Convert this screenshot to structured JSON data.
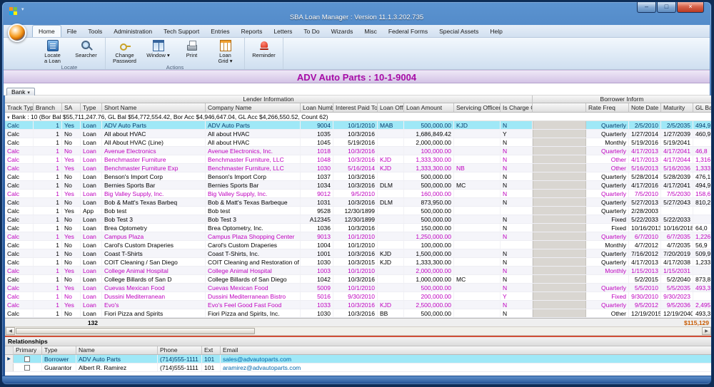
{
  "colors": {
    "banner_text": "#a60ba6",
    "magenta_row_text": "#bf00bf",
    "selected_row_bg": "#9fe8f7",
    "footer_sum_text": "#c85a00",
    "email_link": "#0066aa"
  },
  "window": {
    "title": "SBA Loan Manager : Version 11.1.3.202.735",
    "controls": [
      {
        "name": "minimize",
        "glyph": "–"
      },
      {
        "name": "maximize",
        "glyph": "□"
      },
      {
        "name": "close",
        "glyph": "×"
      }
    ]
  },
  "tabs": [
    "Home",
    "File",
    "Tools",
    "Administration",
    "Tech Support",
    "Entries",
    "Reports",
    "Letters",
    "To Do",
    "Wizards",
    "Misc",
    "Federal Forms",
    "Special Assets",
    "Help"
  ],
  "selected_tab": "Home",
  "ribbon": {
    "groups": [
      {
        "label": "Locate",
        "buttons": [
          {
            "label": "Locate\na Loan",
            "icon": "locate-loan",
            "dropdown": false
          },
          {
            "label": "Searcher",
            "icon": "searcher",
            "dropdown": false
          }
        ]
      },
      {
        "label": "Actions",
        "buttons": [
          {
            "label": "Change\nPassword",
            "icon": "change-password",
            "dropdown": false
          },
          {
            "label": "Window",
            "icon": "window",
            "dropdown": true
          },
          {
            "label": "Print",
            "icon": "print",
            "dropdown": false
          },
          {
            "label": "Loan\nGrid",
            "icon": "loan-grid",
            "dropdown": true
          }
        ]
      },
      {
        "label": "",
        "buttons": [
          {
            "label": "Reminder",
            "icon": "reminder",
            "dropdown": false
          }
        ]
      }
    ]
  },
  "banner": "ADV Auto Parts : 10-1-9004",
  "grid": {
    "group_by_button": "Bank",
    "bands": [
      "Lender Information",
      "Borrower Inform"
    ],
    "columns": [
      "Track Type",
      "Branch",
      "SA",
      "Type",
      "Short Name",
      "Company Name",
      "Loan Number",
      "Interest Paid To",
      "Loan Officer",
      "Loan Amount",
      "Servicing Officer",
      "Is Charge Off",
      "",
      "Rate Freq",
      "Note Date",
      "Maturity",
      "GL Balanc"
    ],
    "group_row": "Bank : 10 (Bor Bal $55,711,247.76, GL Bal $54,772,554.42, Bor Acc $4,946,647.04, GL Acc $4,266,550.52, Count 62)",
    "rows": [
      {
        "style": "selected",
        "cells": [
          "Calc",
          "1",
          "Yes",
          "Loan",
          "ADV Auto Parts",
          "ADV Auto Parts",
          "9004",
          "10/1/2010",
          "MAB",
          "500,000.00",
          "KJD",
          "N",
          "",
          "Quarterly",
          "2/5/2010",
          "2/5/2035",
          "494,9"
        ]
      },
      {
        "style": "",
        "cells": [
          "Calc",
          "1",
          "No",
          "Loan",
          "All about HVAC",
          "All about HVAC",
          "1035",
          "10/3/2016",
          "",
          "1,686,849.42",
          "",
          "Y",
          "",
          "Quarterly",
          "1/27/2014",
          "1/27/2039",
          "460,9"
        ]
      },
      {
        "style": "",
        "cells": [
          "Calc",
          "1",
          "No",
          "Loan",
          "All About HVAC (Line)",
          "All about HVAC",
          "1045",
          "5/19/2016",
          "",
          "2,000,000.00",
          "",
          "N",
          "",
          "Monthly",
          "5/19/2016",
          "5/19/2041",
          ""
        ]
      },
      {
        "style": "magenta",
        "cells": [
          "Calc",
          "1",
          "No",
          "Loan",
          "Avenue Electronics",
          "Avenue Electronics, Inc.",
          "1018",
          "10/3/2016",
          "",
          "100,000.00",
          "",
          "N",
          "",
          "Quarterly",
          "4/17/2013",
          "4/17/2041",
          "46,8"
        ]
      },
      {
        "style": "magenta",
        "cells": [
          "Calc",
          "1",
          "Yes",
          "Loan",
          "Benchmaster Furniture",
          "Benchmaster Furniture, LLC",
          "1048",
          "10/3/2016",
          "KJD",
          "1,333,300.00",
          "",
          "N",
          "",
          "Other",
          "4/17/2013",
          "4/17/2044",
          "1,316,4"
        ]
      },
      {
        "style": "magenta",
        "cells": [
          "Calc",
          "1",
          "Yes",
          "Loan",
          "Benchmaster Furniture Exp",
          "Benchmaster Furniture, LLC",
          "1030",
          "5/16/2014",
          "KJD",
          "1,333,300.00",
          "NB",
          "N",
          "",
          "Other",
          "5/16/2013",
          "5/16/2036",
          "1,333,3"
        ]
      },
      {
        "style": "",
        "cells": [
          "Calc",
          "1",
          "No",
          "Loan",
          "Benson's Import Corp",
          "Benson's Import Corp",
          "1037",
          "10/3/2016",
          "",
          "500,000.00",
          "",
          "N",
          "",
          "Quarterly",
          "5/28/2014",
          "5/28/2039",
          "476,1"
        ]
      },
      {
        "style": "",
        "cells": [
          "Calc",
          "1",
          "No",
          "Loan",
          "Bernies Sports Bar",
          "Bernies Sports Bar",
          "1034",
          "10/3/2016",
          "DLM",
          "500,000.00",
          "MC",
          "N",
          "",
          "Quarterly",
          "4/17/2016",
          "4/17/2041",
          "494,9"
        ]
      },
      {
        "style": "magenta",
        "cells": [
          "Calc",
          "1",
          "Yes",
          "Loan",
          "Big Valley Supply, Inc.",
          "Big Valley Supply, Inc.",
          "9012",
          "9/5/2010",
          "",
          "160,000.00",
          "",
          "N",
          "",
          "Quarterly",
          "7/5/2010",
          "7/5/2030",
          "158,6"
        ]
      },
      {
        "style": "",
        "cells": [
          "Calc",
          "1",
          "No",
          "Loan",
          "Bob & Matt's Texas Barbeq",
          "Bob & Matt's Texas Barbeque",
          "1031",
          "10/3/2016",
          "DLM",
          "873,950.00",
          "",
          "N",
          "",
          "Quarterly",
          "5/27/2013",
          "5/27/2043",
          "810,2"
        ]
      },
      {
        "style": "",
        "cells": [
          "Calc",
          "1",
          "Yes",
          "App",
          "Bob test",
          "Bob test",
          "9528",
          "12/30/1899",
          "",
          "500,000.00",
          "",
          "",
          "",
          "Quarterly",
          "2/28/2003",
          "",
          ""
        ]
      },
      {
        "style": "",
        "cells": [
          "Calc",
          "1",
          "No",
          "Loan",
          "Bob Test 3",
          "Bob Test 3",
          "A12345",
          "12/30/1899",
          "",
          "500,000.00",
          "",
          "N",
          "",
          "Fixed",
          "5/22/2033",
          "5/22/2033",
          ""
        ]
      },
      {
        "style": "",
        "cells": [
          "Calc",
          "1",
          "No",
          "Loan",
          "Brea Optometry",
          "Brea Optometry, Inc.",
          "1036",
          "10/3/2016",
          "",
          "150,000.00",
          "",
          "N",
          "",
          "Fixed",
          "10/16/2013",
          "10/16/2018",
          "64,0"
        ]
      },
      {
        "style": "magenta",
        "cells": [
          "Calc",
          "1",
          "Yes",
          "Loan",
          "Campus Plaza",
          "Campus Plaza Shopping Center",
          "9013",
          "10/1/2010",
          "",
          "1,250,000.00",
          "",
          "N",
          "",
          "Quarterly",
          "6/7/2010",
          "6/7/2035",
          "1,226,7"
        ]
      },
      {
        "style": "",
        "cells": [
          "Calc",
          "1",
          "No",
          "Loan",
          "Carol's Custom Draperies",
          "Carol's Custom Draperies",
          "1004",
          "10/1/2010",
          "",
          "100,000.00",
          "",
          "",
          "",
          "Monthly",
          "4/7/2012",
          "4/7/2035",
          "56,9"
        ]
      },
      {
        "style": "",
        "cells": [
          "Calc",
          "1",
          "No",
          "Loan",
          "Coast T-Shirts",
          "Coast T-Shirts, Inc.",
          "1001",
          "10/3/2016",
          "KJD",
          "1,500,000.00",
          "",
          "N",
          "",
          "Quarterly",
          "7/16/2012",
          "7/20/2019",
          "509,9"
        ]
      },
      {
        "style": "",
        "cells": [
          "Calc",
          "1",
          "No",
          "Loan",
          "COIT Cleaning / San Diego",
          "COIT Cleaning and Restoration of San Die",
          "1030",
          "10/3/2015",
          "KJD",
          "1,333,300.00",
          "",
          "N",
          "",
          "Quarterly",
          "4/17/2013",
          "4/17/2038",
          "1,233,3"
        ]
      },
      {
        "style": "magenta",
        "cells": [
          "Calc",
          "1",
          "Yes",
          "Loan",
          "College Animal Hospital",
          "College Animal Hospital",
          "1003",
          "10/1/2010",
          "",
          "2,000,000.00",
          "",
          "N",
          "",
          "Monthly",
          "1/15/2013",
          "1/15/2031",
          ""
        ]
      },
      {
        "style": "",
        "cells": [
          "Calc",
          "1",
          "No",
          "Loan",
          "College Billards of San D",
          "College Billards of San Diego",
          "1042",
          "10/3/2016",
          "",
          "1,000,000.00",
          "MC",
          "N",
          "",
          "",
          "5/2/2015",
          "5/2/2040",
          "873,8"
        ]
      },
      {
        "style": "magenta",
        "cells": [
          "Calc",
          "1",
          "Yes",
          "Loan",
          "Cuevas Mexican Food",
          "Cuevas Mexican Food",
          "5009",
          "10/1/2010",
          "",
          "500,000.00",
          "",
          "N",
          "",
          "Quarterly",
          "5/5/2010",
          "5/5/2035",
          "493,3"
        ]
      },
      {
        "style": "magenta",
        "cells": [
          "Calc",
          "1",
          "No",
          "Loan",
          "Dussini Mediterranean",
          "Dussini Mediterranean Bistro",
          "5016",
          "9/30/2010",
          "",
          "200,000.00",
          "",
          "Y",
          "",
          "Fixed",
          "9/30/2010",
          "9/30/2023",
          ""
        ]
      },
      {
        "style": "magenta",
        "cells": [
          "Calc",
          "1",
          "Yes",
          "Loan",
          "Evo's",
          "Evo's Feel Good Fast Food",
          "1033",
          "10/3/2016",
          "KJD",
          "2,500,000.00",
          "",
          "N",
          "",
          "Quarterly",
          "9/5/2012",
          "9/5/2036",
          "2,495,6"
        ]
      },
      {
        "style": "",
        "cells": [
          "Calc",
          "1",
          "No",
          "Loan",
          "Fiori Pizza and Spirits",
          "Fiori Pizza and Spirits, Inc.",
          "1030",
          "10/3/2016",
          "BB",
          "500,000.00",
          "",
          "N",
          "",
          "Other",
          "12/19/2015",
          "12/19/2040",
          "493,3"
        ]
      }
    ],
    "footer": {
      "count": "132",
      "sum": "$115,129"
    }
  },
  "relationships": {
    "title": "Relationships",
    "columns": [
      "Primary",
      "Type",
      "Name",
      "Phone",
      "Ext",
      "Email"
    ],
    "rows": [
      {
        "selected": true,
        "primary_checked": false,
        "type": "Borrower",
        "name": "ADV Auto Parts",
        "phone": "(714)555-1111",
        "ext": "101",
        "email": "sales@advautoparts.com"
      },
      {
        "selected": false,
        "primary_checked": false,
        "type": "Guarantor",
        "name": "Albert R. Ramirez",
        "phone": "(714)555-1111",
        "ext": "101",
        "email": "aramirez@advautoparts.com"
      }
    ]
  }
}
